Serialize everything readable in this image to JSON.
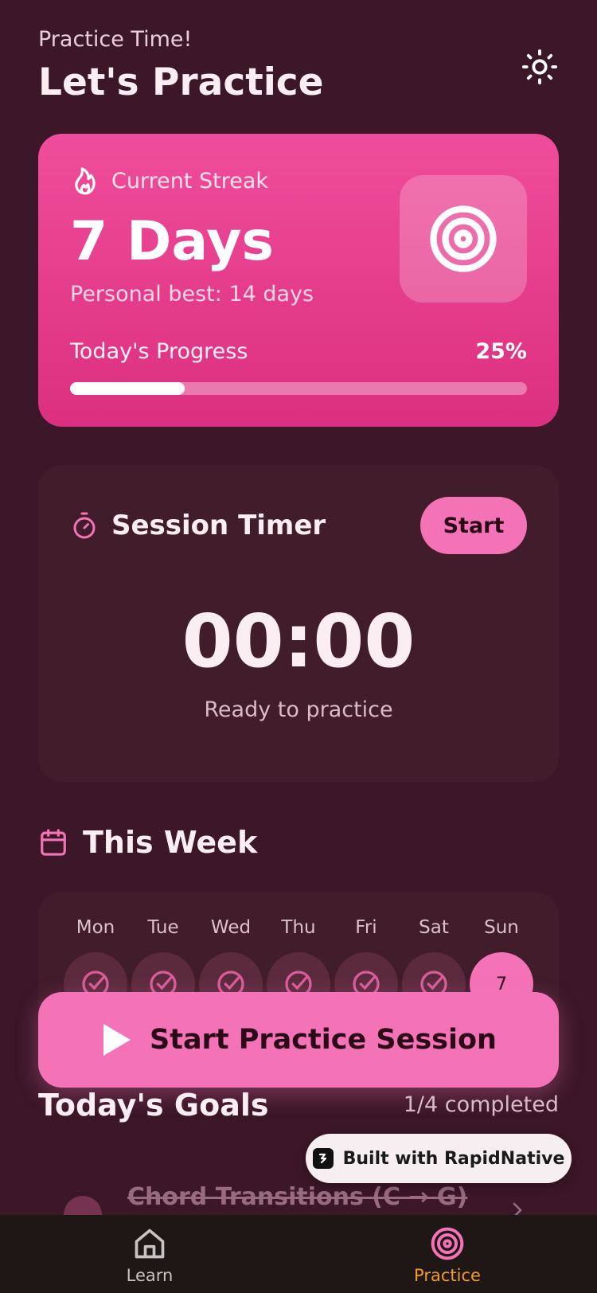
{
  "header": {
    "subtitle": "Practice Time!",
    "title": "Let's Practice",
    "theme_icon": "sun-icon"
  },
  "streak": {
    "label": "Current Streak",
    "value": "7 Days",
    "best": "Personal best: 14 days",
    "progress_label": "Today's Progress",
    "progress_text": "25%",
    "progress_fraction": 0.25
  },
  "timer": {
    "title": "Session Timer",
    "start_label": "Start",
    "value": "00:00",
    "status": "Ready to practice"
  },
  "week": {
    "title": "This Week",
    "days": [
      {
        "label": "Mon",
        "done": true
      },
      {
        "label": "Tue",
        "done": true
      },
      {
        "label": "Wed",
        "done": true
      },
      {
        "label": "Thu",
        "done": true
      },
      {
        "label": "Fri",
        "done": true
      },
      {
        "label": "Sat",
        "done": true
      },
      {
        "label": "Sun",
        "done": false,
        "number": "7"
      }
    ]
  },
  "cta": {
    "label": "Start Practice Session"
  },
  "goals": {
    "title": "Today's Goals",
    "count": "1/4 completed",
    "items": [
      {
        "name": "Chord Transitions (C → G)",
        "done": true
      }
    ]
  },
  "badge": {
    "label": "Built with RapidNative"
  },
  "tabs": [
    {
      "label": "Learn",
      "active": false
    },
    {
      "label": "Practice",
      "active": true
    }
  ],
  "colors": {
    "background": "#3c1727",
    "card": "#411c2a",
    "accent": "#f472b6",
    "streak_gradient_top": "#ef4d9b",
    "active_tab": "#f39a2c"
  }
}
